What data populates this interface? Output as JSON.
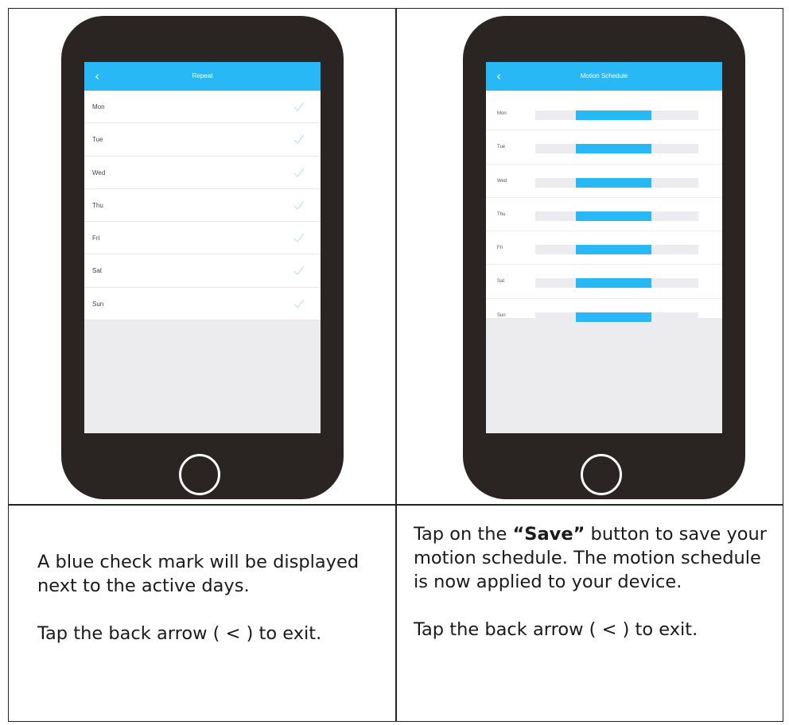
{
  "left_phone": {
    "title": "Repeat",
    "days": [
      "Mon",
      "Tue",
      "Wed",
      "Thu",
      "Fri",
      "Sat",
      "Sun"
    ],
    "checked": [
      true,
      true,
      true,
      true,
      true,
      true,
      true
    ]
  },
  "right_phone": {
    "title": "Motion Schedule",
    "days": [
      "Mon",
      "Tue",
      "Wed",
      "Thu",
      "Fri",
      "Sat",
      "Sun"
    ]
  },
  "left_caption": {
    "line1": "A blue check mark will be displayed next to the active days.",
    "line2": "Tap the back arrow ( < ) to exit."
  },
  "right_caption": {
    "pre": "Tap on the ",
    "bold": "“Save”",
    "post": " button to save your motion schedule. The motion schedule is now applied to your device.",
    "line2": "Tap the back arrow ( < ) to exit."
  },
  "colors": {
    "accent": "#27b8f5",
    "phone_body": "#2a2523",
    "screen_bg": "#ececee"
  }
}
